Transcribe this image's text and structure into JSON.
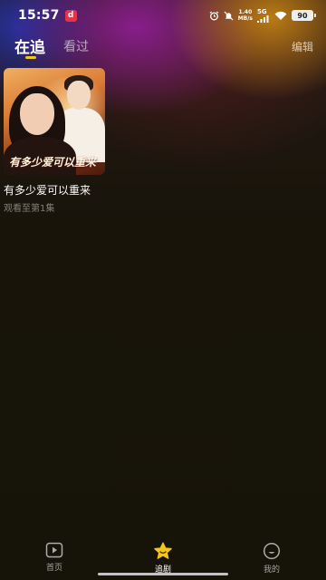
{
  "status_bar": {
    "time": "15:57",
    "app_badge": "d",
    "net_speed_value": "1.40",
    "net_speed_unit": "MB/s",
    "network": "5G",
    "battery": "90",
    "icons": [
      "alarm-icon",
      "mute-icon",
      "signal-icon",
      "wifi-icon",
      "battery-icon"
    ]
  },
  "header": {
    "tabs": [
      {
        "label": "在追",
        "active": true
      },
      {
        "label": "看过",
        "active": false
      }
    ],
    "edit_label": "编辑",
    "accent": "#f5c518"
  },
  "watchlist": [
    {
      "poster_text": "有多少爱可以重来",
      "title": "有多少爱可以重来",
      "progress": "观看至第1集"
    }
  ],
  "bottom_nav": [
    {
      "label": "首页",
      "icon": "play-icon",
      "active": false
    },
    {
      "label": "追剧",
      "icon": "star-icon",
      "active": true
    },
    {
      "label": "我的",
      "icon": "smile-icon",
      "active": false
    }
  ]
}
